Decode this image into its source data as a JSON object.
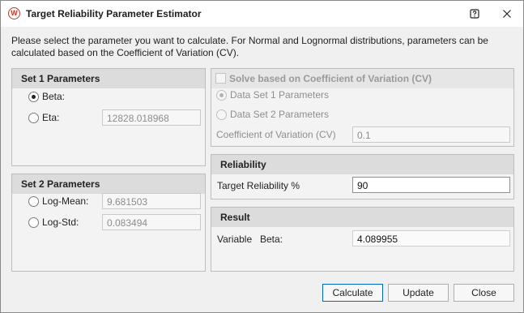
{
  "window": {
    "title": "Target Reliability Parameter Estimator",
    "app_icon_letter": "W",
    "help_icon": "help-icon",
    "close_icon": "close-icon"
  },
  "intro_text": "Please select the parameter you want to calculate. For Normal and Lognormal distributions, parameters can be calculated based on the Coefficient of Variation (CV).",
  "set1": {
    "title": "Set 1 Parameters",
    "beta_label": "Beta:",
    "eta_label": "Eta:",
    "eta_value": "12828.018968",
    "selected": "beta"
  },
  "set2": {
    "title": "Set 2 Parameters",
    "logmean_label": "Log-Mean:",
    "logmean_value": "9.681503",
    "logstd_label": "Log-Std:",
    "logstd_value": "0.083494"
  },
  "cv": {
    "checkbox_label": "Solve based on Coefficient of Variation (CV)",
    "checked": false,
    "data_set1_label": "Data Set 1 Parameters",
    "data_set2_label": "Data Set 2 Parameters",
    "cv_label": "Coefficient of Variation (CV)",
    "cv_value": "0.1"
  },
  "reliability": {
    "title": "Reliability",
    "target_label": "Target Reliability %",
    "target_value": "90"
  },
  "result": {
    "title": "Result",
    "variable_label": "Variable",
    "param_label": "Beta:",
    "value": "4.089955"
  },
  "buttons": {
    "calculate": "Calculate",
    "update": "Update",
    "close": "Close"
  },
  "colors": {
    "accent": "#0067c0",
    "app_icon": "#c0392b",
    "group_header": "#dcdcdc"
  }
}
